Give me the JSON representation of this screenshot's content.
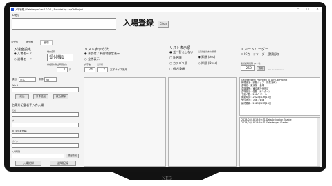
{
  "window": {
    "title": "入場管理 / Gatekeeper Ver.2.0.0.1 / Provided by AnyOb Project",
    "minimize": "–",
    "maximize": "□",
    "close": "×"
  },
  "reception": {
    "label": "ID受付",
    "input_value": "",
    "register_button": "入場登録",
    "clear_button": "Clear"
  },
  "tabs": [
    {
      "label": "未受付",
      "active": false
    },
    {
      "label": "財団等",
      "active": false
    },
    {
      "label": "管理",
      "active": true
    }
  ],
  "entry_settings": {
    "title": "入退室設定",
    "modes": [
      "入場モード",
      "退場モード"
    ],
    "selected_mode": "入場モード",
    "terminal_label": "端末名称",
    "terminal_value": "受付機1",
    "duplicate_label": "重複受付防止時間(分)",
    "duplicate_value": "3",
    "duplicate_unit": "円"
  },
  "list_display": {
    "title": "リスト表示方法",
    "options": [
      "未受付／未退場限定表示",
      "全件表示"
    ],
    "selected": "未受付／未退場限定表示",
    "font_size_label": "文字数",
    "font_size_value": "24",
    "row_label": "表示行",
    "row_value": "12",
    "apply_button": "文字サイズ適用"
  },
  "list_order": {
    "title": "リスト表示順",
    "options": [
      "並べ替えしない",
      "氏名順",
      "カテゴリ順",
      "個人ID順"
    ],
    "selected": "並べ替えしない",
    "sort_label": "表示順並替方向(昇順)",
    "sort_options": [
      "昇順 (Asc)",
      "降順 (Desc)"
    ],
    "selected_sort": "昇順 (Asc)"
  },
  "ic_reader": {
    "title": "ICカードリーダー",
    "checkbox_label": "ICカードリーダー連続読取",
    "interval_label": "連続読取間隔 (×1 秒)",
    "interval_value": "250",
    "apply_button": "適用",
    "status_text": "ID Lite Initialize"
  },
  "filter": {
    "field_label": "項目",
    "field_value": "氏名",
    "condition_label": "条件",
    "condition_value": "含む",
    "keyword_label": "Word",
    "keyword_value": "",
    "narrow_button": "絞込",
    "add_condition_button": "条件追加",
    "clear_button": "絞込解除"
  },
  "manual_entry": {
    "title": "名簿外記載者手入力入場",
    "fields": [
      "氏名",
      "ｶﾅ",
      "ID (電話番号等)",
      "ｶﾃｺﾞﾘｰ",
      "入場時刻"
    ],
    "time_button": "現在時刻",
    "entry_button": "入場記録",
    "exit_button": "退場記録"
  },
  "info_log": [
    "Gatekeeper | Provided by AnyOb Project",
    "管理者名：安藤ジョブ（所属名称）",
    "会場名：東京第一会場",
    "会場場所：東京都千代田区",
    "会場担当：佐藤（センター）",
    "予定人数：200人 ホール",
    "開始時刻：2023年03月18日",
    "受付状況：入場／退場",
    "最終更新：2023年03月18日"
  ],
  "event_log": [
    "2023/03/18 13:59:51 DataActivation Enable",
    "2023/03/18 13:59:51 Gatekeeper Started"
  ],
  "brand": "NES"
}
